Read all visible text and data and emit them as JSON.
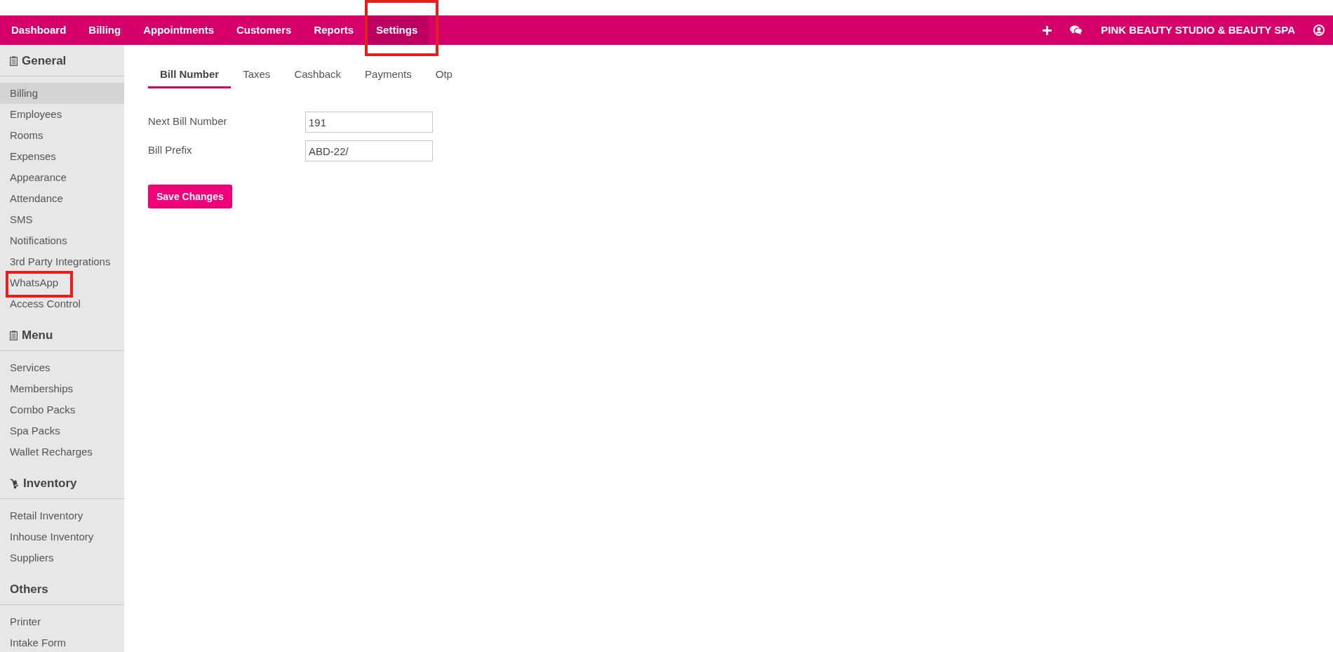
{
  "navbar": {
    "items": [
      {
        "label": "Dashboard",
        "selected": false,
        "highlighted": false
      },
      {
        "label": "Billing",
        "selected": false,
        "highlighted": false
      },
      {
        "label": "Appointments",
        "selected": false,
        "highlighted": false
      },
      {
        "label": "Customers",
        "selected": false,
        "highlighted": false
      },
      {
        "label": "Reports",
        "selected": false,
        "highlighted": false
      },
      {
        "label": "Settings",
        "selected": true,
        "highlighted": true
      }
    ],
    "business_name": "PINK BEAUTY STUDIO & BEAUTY SPA"
  },
  "sidebar": {
    "sections": [
      {
        "title": "General",
        "kind": "clipboard",
        "items": [
          {
            "label": "Billing",
            "selected": true,
            "highlighted": false
          },
          {
            "label": "Employees",
            "selected": false,
            "highlighted": false
          },
          {
            "label": "Rooms",
            "selected": false,
            "highlighted": false
          },
          {
            "label": "Expenses",
            "selected": false,
            "highlighted": false
          },
          {
            "label": "Appearance",
            "selected": false,
            "highlighted": false
          },
          {
            "label": "Attendance",
            "selected": false,
            "highlighted": false
          },
          {
            "label": "SMS",
            "selected": false,
            "highlighted": false
          },
          {
            "label": "Notifications",
            "selected": false,
            "highlighted": false
          },
          {
            "label": "3rd Party Integrations",
            "selected": false,
            "highlighted": false
          },
          {
            "label": "WhatsApp",
            "selected": false,
            "highlighted": true
          },
          {
            "label": "Access Control",
            "selected": false,
            "highlighted": false
          }
        ]
      },
      {
        "title": "Menu",
        "kind": "clipboard",
        "items": [
          {
            "label": "Services",
            "selected": false,
            "highlighted": false
          },
          {
            "label": "Memberships",
            "selected": false,
            "highlighted": false
          },
          {
            "label": "Combo Packs",
            "selected": false,
            "highlighted": false
          },
          {
            "label": "Spa Packs",
            "selected": false,
            "highlighted": false
          },
          {
            "label": "Wallet Recharges",
            "selected": false,
            "highlighted": false
          }
        ]
      },
      {
        "title": "Inventory",
        "kind": "dolly",
        "items": [
          {
            "label": "Retail Inventory",
            "selected": false,
            "highlighted": false
          },
          {
            "label": "Inhouse Inventory",
            "selected": false,
            "highlighted": false
          },
          {
            "label": "Suppliers",
            "selected": false,
            "highlighted": false
          }
        ]
      },
      {
        "title": "Others",
        "kind": "plain",
        "items": [
          {
            "label": "Printer",
            "selected": false,
            "highlighted": false
          },
          {
            "label": "Intake Form",
            "selected": false,
            "highlighted": false
          }
        ]
      }
    ]
  },
  "tabs": [
    {
      "label": "Bill Number",
      "selected": true
    },
    {
      "label": "Taxes",
      "selected": false
    },
    {
      "label": "Cashback",
      "selected": false
    },
    {
      "label": "Payments",
      "selected": false
    },
    {
      "label": "Otp",
      "selected": false
    }
  ],
  "form": {
    "fields": [
      {
        "label": "Next Bill Number",
        "value": "191"
      },
      {
        "label": "Bill Prefix",
        "value": "ABD-22/"
      }
    ],
    "save_button": "Save Changes"
  }
}
